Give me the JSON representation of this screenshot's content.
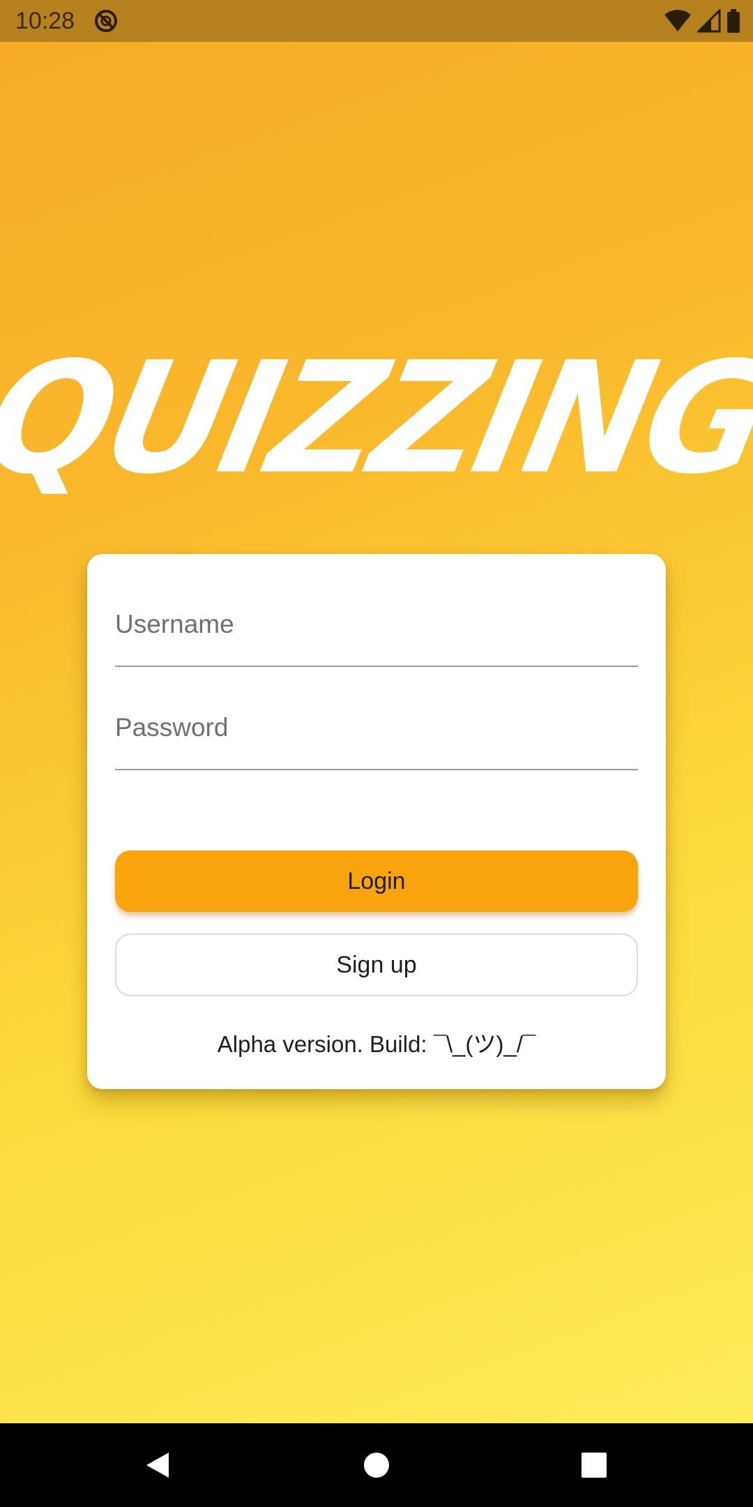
{
  "status_bar": {
    "time": "10:28",
    "app_icon": "no-disturb-icon",
    "icons": [
      "wifi-icon",
      "cell-signal-icon",
      "battery-icon"
    ]
  },
  "logo": {
    "text": "QUIZZING"
  },
  "login_form": {
    "username_placeholder": "Username",
    "password_placeholder": "Password",
    "login_label": "Login",
    "signup_label": "Sign up",
    "version_text": "Alpha version. Build: ¯\\_(ツ)_/¯"
  },
  "nav_bar": {
    "back": "back-icon",
    "home": "home-icon",
    "recents": "recents-icon"
  },
  "colors": {
    "background_top": "#f8ab28",
    "background_bottom": "#fdee5d",
    "status_bar": "#b8811f",
    "login_button": "#f9a40c",
    "card": "#ffffff"
  }
}
